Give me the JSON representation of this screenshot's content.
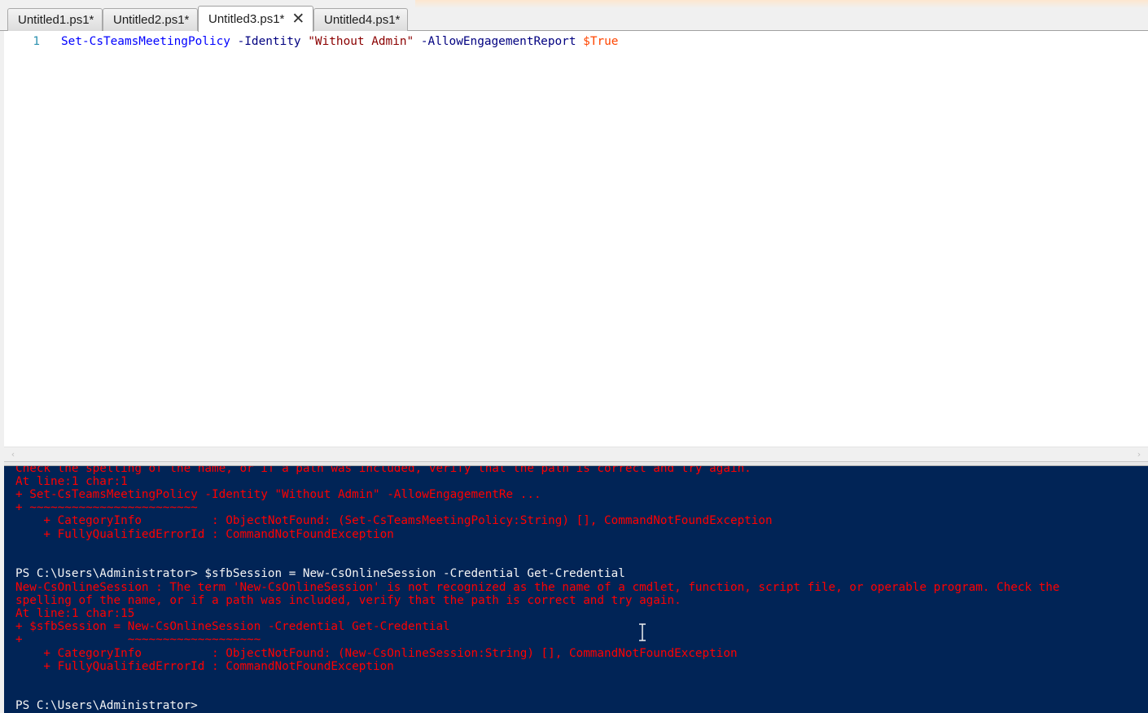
{
  "tabs": [
    {
      "label": "Untitled1.ps1*",
      "active": false
    },
    {
      "label": "Untitled2.ps1*",
      "active": false
    },
    {
      "label": "Untitled3.ps1*",
      "active": true
    },
    {
      "label": "Untitled4.ps1*",
      "active": false
    }
  ],
  "close_glyph": "✕",
  "editor": {
    "line_number": "1",
    "tokens": {
      "cmdlet": "Set-CsTeamsMeetingPolicy",
      "param1": " -Identity ",
      "string": "\"Without Admin\"",
      "param2": " -AllowEngagementReport ",
      "variable": "$True"
    }
  },
  "scrollbar": {
    "left_arrow": "‹",
    "right_arrow": "›"
  },
  "console": {
    "lines": [
      {
        "text": "Check the spelling of the name, or if a path was included, verify that the path is correct and try again.",
        "kind": "err"
      },
      {
        "text": "At line:1 char:1",
        "kind": "err"
      },
      {
        "text": "+ Set-CsTeamsMeetingPolicy -Identity \"Without Admin\" -AllowEngagementRe ...",
        "kind": "err"
      },
      {
        "text": "+ ~~~~~~~~~~~~~~~~~~~~~~~~",
        "kind": "err"
      },
      {
        "text": "    + CategoryInfo          : ObjectNotFound: (Set-CsTeamsMeetingPolicy:String) [], CommandNotFoundException",
        "kind": "err"
      },
      {
        "text": "    + FullyQualifiedErrorId : CommandNotFoundException",
        "kind": "err"
      },
      {
        "text": "PS C:\\Users\\Administrator> $sfbSession = New-CsOnlineSession -Credential Get-Credential",
        "kind": "ps"
      },
      {
        "text": "New-CsOnlineSession : The term 'New-CsOnlineSession' is not recognized as the name of a cmdlet, function, script file, or operable program. Check the",
        "kind": "err"
      },
      {
        "text": "spelling of the name, or if a path was included, verify that the path is correct and try again.",
        "kind": "err"
      },
      {
        "text": "At line:1 char:15",
        "kind": "err"
      },
      {
        "text": "+ $sfbSession = New-CsOnlineSession -Credential Get-Credential",
        "kind": "err"
      },
      {
        "text": "+               ~~~~~~~~~~~~~~~~~~~",
        "kind": "err"
      },
      {
        "text": "    + CategoryInfo          : ObjectNotFound: (New-CsOnlineSession:String) [], CommandNotFoundException",
        "kind": "err"
      },
      {
        "text": "    + FullyQualifiedErrorId : CommandNotFoundException",
        "kind": "err"
      },
      {
        "text": "PS C:\\Users\\Administrator>",
        "kind": "ps"
      }
    ]
  }
}
